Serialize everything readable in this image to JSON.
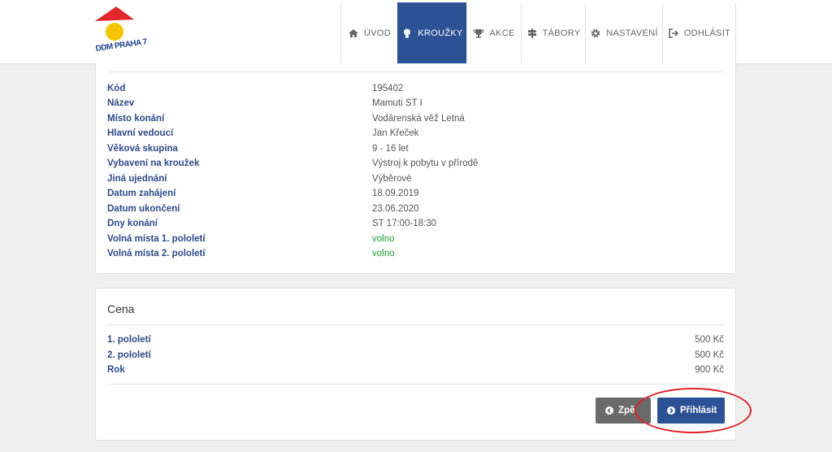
{
  "logo": {
    "text": "DDM PRAHA 7"
  },
  "nav": [
    {
      "label": "Úvod",
      "icon": "home-icon",
      "active": false
    },
    {
      "label": "Kroužky",
      "icon": "lightbulb-icon",
      "active": true
    },
    {
      "label": "Akce",
      "icon": "trophy-icon",
      "active": false
    },
    {
      "label": "Tábory",
      "icon": "signpost-icon",
      "active": false
    },
    {
      "label": "Nastavení",
      "icon": "gear-icon",
      "active": false
    },
    {
      "label": "Odhlásit",
      "icon": "sign-out-icon",
      "active": false
    }
  ],
  "info": [
    {
      "label": "Kód",
      "value": "195402",
      "status": false
    },
    {
      "label": "Název",
      "value": "Mamuti ST I",
      "status": false
    },
    {
      "label": "Místo konání",
      "value": "Vodárenská věž Letná",
      "status": false
    },
    {
      "label": "Hlavní vedoucí",
      "value": "Jan Křeček",
      "status": false
    },
    {
      "label": "Věková skupina",
      "value": "9 - 16 let",
      "status": false
    },
    {
      "label": "Vybavení na kroužek",
      "value": "Výstroj k pobytu v přírodě",
      "status": false
    },
    {
      "label": "Jiná ujednání",
      "value": "Výběrové",
      "status": false
    },
    {
      "label": "Datum zahájení",
      "value": "18.09.2019",
      "status": false
    },
    {
      "label": "Datum ukončení",
      "value": "23.06.2020",
      "status": false
    },
    {
      "label": "Dny konání",
      "value": "ST 17:00-18:30",
      "status": false
    },
    {
      "label": "Volná místa 1. pololetí",
      "value": "volno",
      "status": true
    },
    {
      "label": "Volná místa 2. pololetí",
      "value": "volno",
      "status": true
    }
  ],
  "price": {
    "title": "Cena",
    "rows": [
      {
        "label": "1. pololetí",
        "value": "500 Kč"
      },
      {
        "label": "2. pololetí",
        "value": "500 Kč"
      },
      {
        "label": "Rok",
        "value": "900 Kč"
      }
    ]
  },
  "buttons": {
    "back": "Zpě",
    "signup": "Přihlásit"
  },
  "colors": {
    "accent": "#2d5195",
    "label": "#2d4a87",
    "status_ok": "#1f9d3a",
    "highlight": "#e0202a"
  }
}
